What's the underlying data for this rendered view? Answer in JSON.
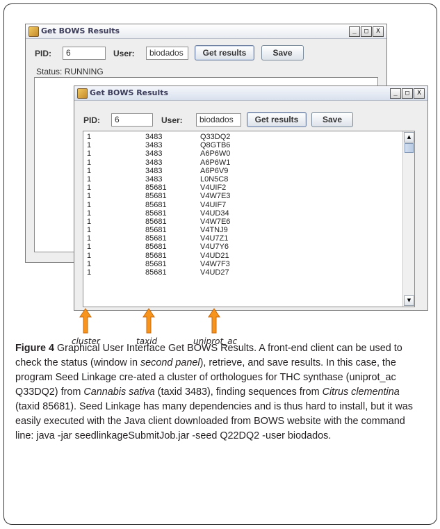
{
  "back_window": {
    "title": "Get BOWS Results",
    "pid_label": "PID:",
    "pid_value": "6",
    "user_label": "User:",
    "user_value": "biodados",
    "get_results_label": "Get results",
    "save_label": "Save",
    "status_text": "Status: RUNNING"
  },
  "front_window": {
    "title": "Get BOWS Results",
    "pid_label": "PID:",
    "pid_value": "6",
    "user_label": "User:",
    "user_value": "biodados",
    "get_results_label": "Get results",
    "save_label": "Save",
    "results": [
      [
        "1",
        "3483",
        "Q33DQ2"
      ],
      [
        "1",
        "3483",
        "Q8GTB6"
      ],
      [
        "1",
        "3483",
        "A6P6W0"
      ],
      [
        "1",
        "3483",
        "A6P6W1"
      ],
      [
        "1",
        "3483",
        "A6P6V9"
      ],
      [
        "1",
        "3483",
        "L0N5C8"
      ],
      [
        "1",
        "85681",
        "V4UIF2"
      ],
      [
        "1",
        "85681",
        "V4W7E3"
      ],
      [
        "1",
        "85681",
        "V4UIF7"
      ],
      [
        "1",
        "85681",
        "V4UD34"
      ],
      [
        "1",
        "85681",
        "V4W7E6"
      ],
      [
        "1",
        "85681",
        "V4TNJ9"
      ],
      [
        "1",
        "85681",
        "V4U7Z1"
      ],
      [
        "1",
        "85681",
        "V4U7Y6"
      ],
      [
        "1",
        "85681",
        "V4UD21"
      ],
      [
        "1",
        "85681",
        "V4W7F3"
      ],
      [
        "1",
        "85681",
        "V4UD27"
      ]
    ],
    "window_buttons": [
      "_",
      "□",
      "X"
    ]
  },
  "callouts": {
    "cluster": "cluster",
    "taxid": "taxid",
    "uniprot_ac": "uniprot_ac"
  },
  "colors": {
    "arrow_fill": "#f7941d",
    "arrow_stroke": "#c96a0c"
  },
  "caption": {
    "label": "Figure 4",
    "text_1": " Graphical User Interface Get BOWS Results. A front-end client can be used to check the status (window in ",
    "em_1": "second panel",
    "text_2": "), retrieve, and save results. In this case, the program Seed Linkage cre-ated a cluster of orthologues for THC synthase (uniprot_ac Q33DQ2) from ",
    "em_2": "Cannabis sativa",
    "text_3": " (taxid 3483), finding sequences from ",
    "em_3": "Citrus clementina",
    "text_4": " (taxid 85681). Seed Linkage has many dependencies and is thus hard to install, but it was easily executed with the Java client downloaded from BOWS website with the command line: java -jar seedlinkageSubmitJob.jar -seed Q22DQ2 -user biodados."
  }
}
